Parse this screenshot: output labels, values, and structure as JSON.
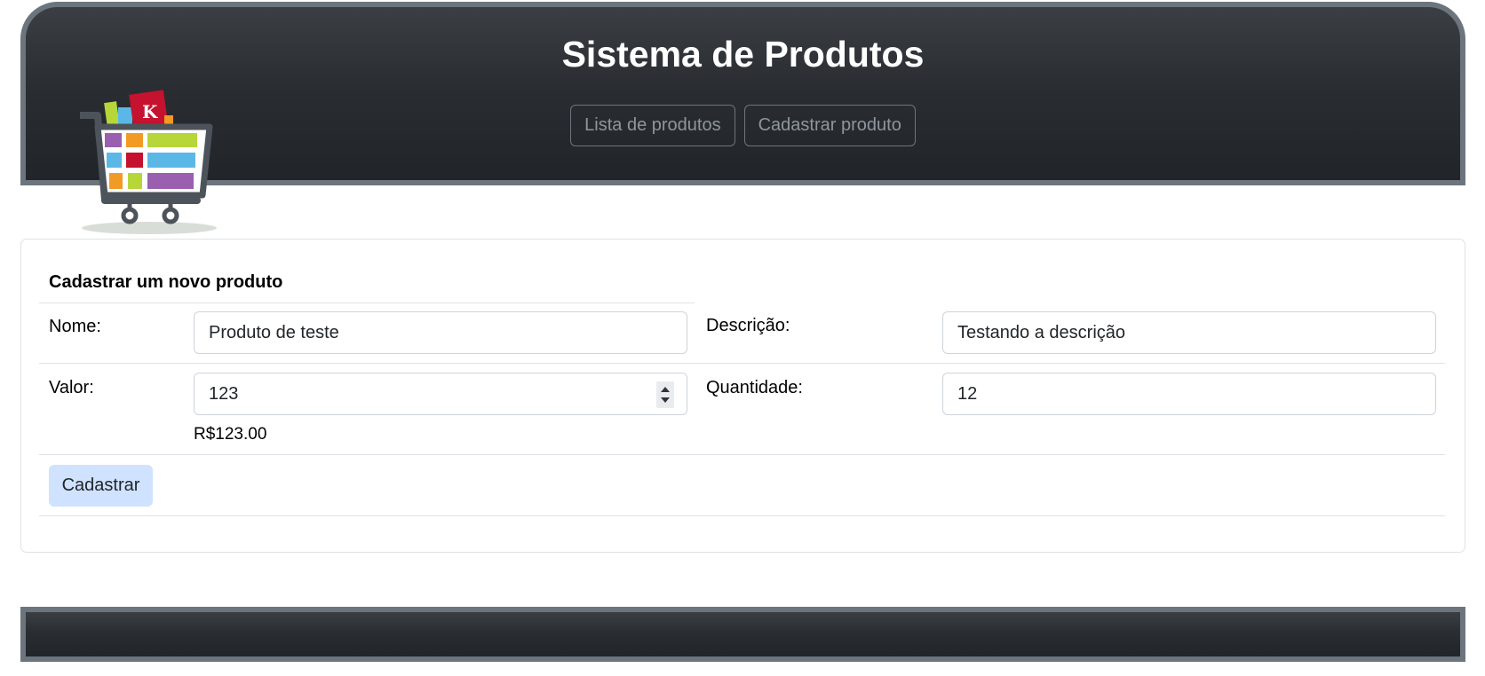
{
  "header": {
    "title": "Sistema de Produtos",
    "nav": [
      "Lista de produtos",
      "Cadastrar produto"
    ],
    "logo_icon": "shopping-cart-icon",
    "logo_badge": "K"
  },
  "form": {
    "title": "Cadastrar um novo produto",
    "nome_label": "Nome:",
    "nome_value": "Produto de teste",
    "descricao_label": "Descrição:",
    "descricao_value": "Testando a descrição",
    "valor_label": "Valor:",
    "valor_value": "123",
    "valor_formatted": "R$123.00",
    "quantidade_label": "Quantidade:",
    "quantidade_value": "12",
    "submit_label": "Cadastrar"
  },
  "colors": {
    "header_dark": "#212529",
    "header_border": "#6c757d",
    "submit_bg": "#cfe2ff"
  }
}
